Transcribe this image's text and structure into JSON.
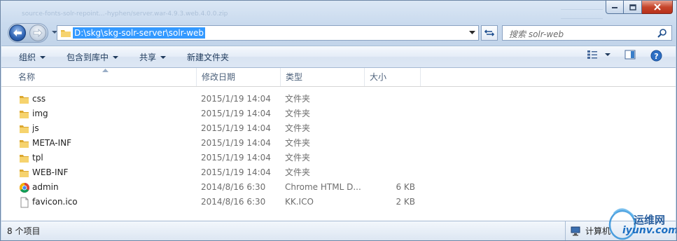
{
  "window": {
    "background_hint_text": "source-fonts-solr-repoint...-hyphen/server.war-4.9.3.web.4.0.0.zip",
    "caption": {
      "minimize_glyph": "minimize",
      "maximize_glyph": "maximize",
      "close_glyph": "close"
    }
  },
  "address": {
    "path": "D:\\skg\\skg-solr-server\\solr-web",
    "icon": "folder-icon"
  },
  "search": {
    "placeholder": "搜索 solr-web",
    "icon": "search-icon"
  },
  "toolbar": {
    "organize": "组织",
    "include_in_library": "包含到库中",
    "share": "共享",
    "new_folder": "新建文件夹"
  },
  "columns": {
    "name": "名称",
    "date": "修改日期",
    "type": "类型",
    "size": "大小"
  },
  "files": [
    {
      "name": "css",
      "date": "2015/1/19 14:04",
      "type": "文件夹",
      "size": "",
      "icon": "folder-icon"
    },
    {
      "name": "img",
      "date": "2015/1/19 14:04",
      "type": "文件夹",
      "size": "",
      "icon": "folder-icon"
    },
    {
      "name": "js",
      "date": "2015/1/19 14:04",
      "type": "文件夹",
      "size": "",
      "icon": "folder-icon"
    },
    {
      "name": "META-INF",
      "date": "2015/1/19 14:04",
      "type": "文件夹",
      "size": "",
      "icon": "folder-icon"
    },
    {
      "name": "tpl",
      "date": "2015/1/19 14:04",
      "type": "文件夹",
      "size": "",
      "icon": "folder-icon"
    },
    {
      "name": "WEB-INF",
      "date": "2015/1/19 14:04",
      "type": "文件夹",
      "size": "",
      "icon": "folder-icon"
    },
    {
      "name": "admin",
      "date": "2014/8/16 6:30",
      "type": "Chrome HTML D...",
      "size": "6 KB",
      "icon": "chrome-icon"
    },
    {
      "name": "favicon.ico",
      "date": "2014/8/16 6:30",
      "type": "KK.ICO",
      "size": "2 KB",
      "icon": "file-icon"
    }
  ],
  "status": {
    "item_count": "8 个项目",
    "location": "计算机"
  },
  "watermark": {
    "brand_cn": "运维网",
    "brand_url": "iyunv.com"
  },
  "colors": {
    "selection": "#3399ff",
    "folder": "#f2c94c",
    "toolbar_text": "#1e395b"
  }
}
